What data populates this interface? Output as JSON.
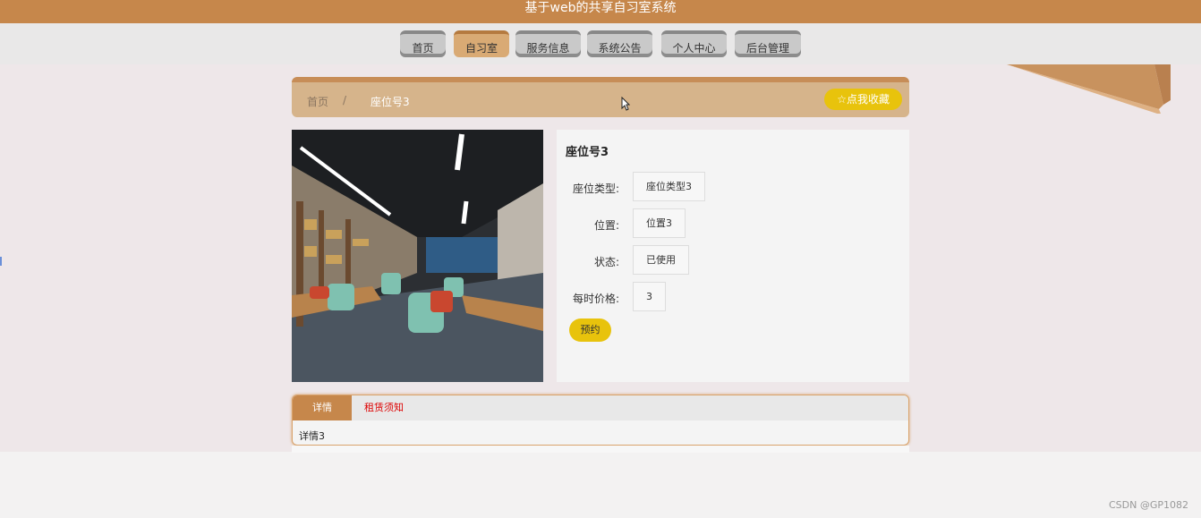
{
  "app": {
    "title": "基于web的共享自习室系统"
  },
  "nav": {
    "items": [
      {
        "label": "首页"
      },
      {
        "label": "自习室"
      },
      {
        "label": "服务信息"
      },
      {
        "label": "系统公告"
      },
      {
        "label": "个人中心"
      },
      {
        "label": "后台管理"
      }
    ],
    "active_index": 1
  },
  "breadcrumb": {
    "home": "首页",
    "separator": "/",
    "current": "座位号3"
  },
  "favorite": {
    "icon": "star-icon",
    "label": "☆点我收藏"
  },
  "detail": {
    "title": "座位号3",
    "fields": [
      {
        "label": "座位类型:",
        "value": "座位类型3"
      },
      {
        "label": "位置:",
        "value": "位置3"
      },
      {
        "label": "状态:",
        "value": "已使用"
      },
      {
        "label": "每时价格:",
        "value": "3"
      }
    ],
    "book_label": "预约"
  },
  "tabs": {
    "items": [
      {
        "label": "详情"
      },
      {
        "label": "租赁须知"
      }
    ],
    "active_index": 0,
    "content": "详情3"
  },
  "watermark": "CSDN @GP1082",
  "colors": {
    "brand": "#c6874b",
    "accent_yellow": "#e8c30c",
    "breadcrumb_bg": "#d6b48b",
    "page_bg": "#eee7e9"
  }
}
